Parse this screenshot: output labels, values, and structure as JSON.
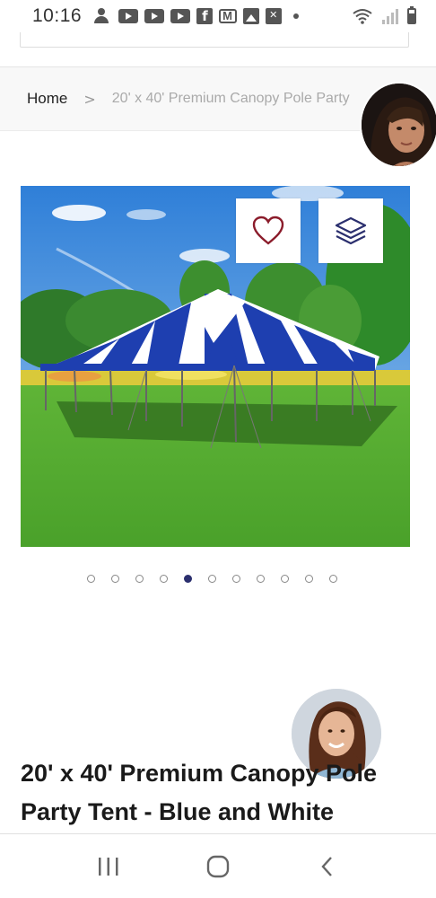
{
  "status_bar": {
    "time": "10:16",
    "icons": [
      "person-add-icon",
      "youtube-icon",
      "youtube-icon",
      "youtube-icon",
      "facebook-icon",
      "gmail-icon",
      "photo-icon",
      "x-app-icon",
      "dot-icon",
      "wifi-icon",
      "signal-icon",
      "battery-icon"
    ]
  },
  "breadcrumb": {
    "home": "Home",
    "separator": ">",
    "current": "20' x 40' Premium Canopy Pole Party"
  },
  "product": {
    "image_alt": "Blue and white striped pole party tent on grass",
    "title": "20' x 40' Premium Canopy Pole Party Tent - Blue and White",
    "wishlist_icon": "heart-icon",
    "compare_icon": "layers-icon"
  },
  "carousel": {
    "total_slides": 11,
    "active_index": 4
  },
  "colors": {
    "brand_dark": "#2b2f6e",
    "heart": "#8b1c2b",
    "tent_blue": "#1e3fb0"
  },
  "nav": {
    "recents_icon": "recents-icon",
    "home_icon": "home-icon",
    "back_icon": "back-icon"
  }
}
